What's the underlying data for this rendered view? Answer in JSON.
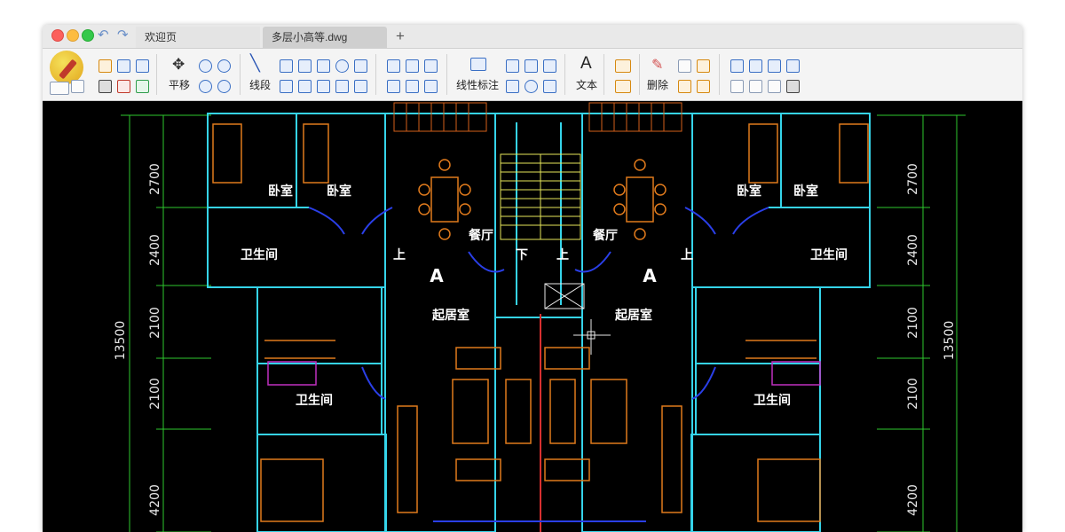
{
  "tabs": [
    {
      "label": "欢迎页"
    },
    {
      "label": "多层小高等.dwg"
    }
  ],
  "add_tab_label": "+",
  "toolbar": {
    "pan_label": "平移",
    "line_label": "线段",
    "linear_dim_label": "线性标注",
    "text_label": "文本",
    "delete_label": "删除"
  },
  "drawing": {
    "left_dims": [
      "2700",
      "2400",
      "2100",
      "2100",
      "4200"
    ],
    "right_dims": [
      "2700",
      "2400",
      "2100",
      "2100",
      "4200"
    ],
    "total_dim": "13500",
    "room_labels": {
      "bedroom_1": "卧室",
      "bedroom_2": "卧室",
      "bedroom_3": "卧室",
      "bedroom_4": "卧室",
      "bath_upper_left": "卫生间",
      "bath_upper_right": "卫生间",
      "bath_lower_left": "卫生间",
      "bath_lower_right": "卫生间",
      "dining_left": "餐厅",
      "dining_right": "餐厅",
      "living_left": "起居室",
      "living_right": "起居室",
      "unit_left": "A",
      "unit_right": "A"
    },
    "stair_labels": {
      "up_1": "上",
      "down": "下",
      "up_2": "上",
      "up_3": "上"
    }
  },
  "colors": {
    "canvas_bg": "#000000",
    "wall": "#35d4ea",
    "furniture": "#e07a1c",
    "dimension": "#2ec82e",
    "door": "#2a3fe8",
    "stair": "#e6e65a",
    "bath": "#c030c0"
  },
  "icons": [
    "undo-icon",
    "redo-icon",
    "pan-icon",
    "zoom-in-icon",
    "zoom-out-icon",
    "line-icon",
    "text-icon",
    "eraser-icon"
  ]
}
